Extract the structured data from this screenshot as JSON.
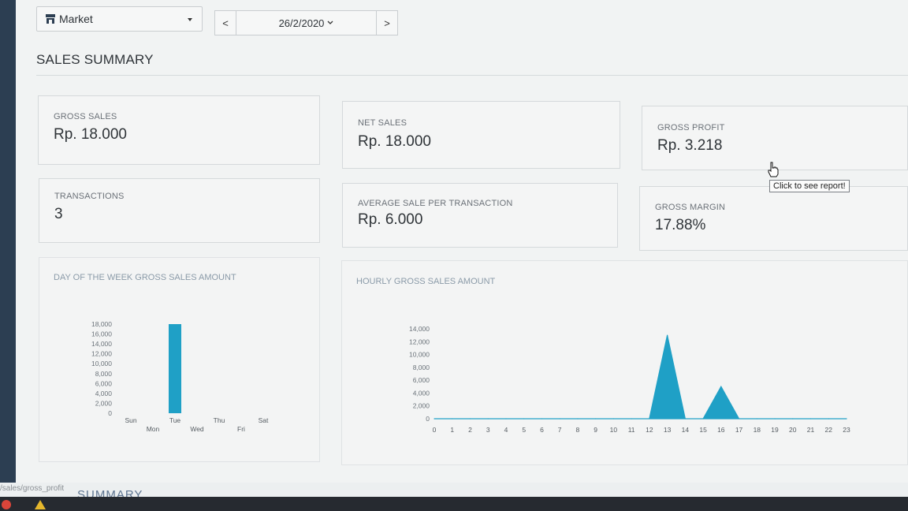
{
  "header": {
    "outlet_label": "Market",
    "date_prev": "<",
    "date_value": "26/2/2020",
    "date_next": ">"
  },
  "page_title": "SALES SUMMARY",
  "cards": {
    "gross_sales": {
      "label": "GROSS SALES",
      "value": "Rp. 18.000"
    },
    "net_sales": {
      "label": "NET SALES",
      "value": "Rp. 18.000"
    },
    "gross_profit": {
      "label": "GROSS PROFIT",
      "value": "Rp. 3.218"
    },
    "transactions": {
      "label": "TRANSACTIONS",
      "value": "3"
    },
    "avg_sale": {
      "label": "AVERAGE SALE PER TRANSACTION",
      "value": "Rp. 6.000"
    },
    "gross_margin": {
      "label": "GROSS MARGIN",
      "value": "17.88%"
    }
  },
  "tooltip": "Click to see report!",
  "status_bar": {
    "url": "/sales/gross_profit",
    "summary_fragment": "SUMMARY"
  },
  "colors": {
    "accent": "#1fa0c6",
    "page_bg": "#f1f3f3",
    "nav_dark": "#2c3e52"
  },
  "icons": {
    "outlet": "store-icon",
    "dropdown": "caret-down-icon",
    "cursor": "hand-pointer-icon"
  },
  "chart_data": [
    {
      "type": "bar",
      "title": "DAY OF THE WEEK GROSS SALES AMOUNT",
      "categories": [
        "Sun",
        "Mon",
        "Tue",
        "Wed",
        "Thu",
        "Fri",
        "Sat"
      ],
      "values": [
        0,
        0,
        18000,
        0,
        0,
        0,
        0
      ],
      "yticks": [
        "18,000",
        "16,000",
        "14,000",
        "12,000",
        "10,000",
        "8,000",
        "6,000",
        "4,000",
        "2,000",
        "0"
      ],
      "ylim": [
        0,
        18000
      ],
      "color": "#1fa0c6"
    },
    {
      "type": "area",
      "title": "HOURLY GROSS SALES AMOUNT",
      "x": [
        0,
        1,
        2,
        3,
        4,
        5,
        6,
        7,
        8,
        9,
        10,
        11,
        12,
        13,
        14,
        15,
        16,
        17,
        18,
        19,
        20,
        21,
        22,
        23
      ],
      "values": [
        0,
        0,
        0,
        0,
        0,
        0,
        0,
        0,
        0,
        0,
        0,
        0,
        0,
        13000,
        0,
        0,
        5000,
        0,
        0,
        0,
        0,
        0,
        0,
        0
      ],
      "yticks": [
        "14,000",
        "12,000",
        "10,000",
        "8,000",
        "6,000",
        "4,000",
        "2,000",
        "0"
      ],
      "ylim": [
        0,
        14000
      ],
      "color": "#1fa0c6"
    }
  ]
}
